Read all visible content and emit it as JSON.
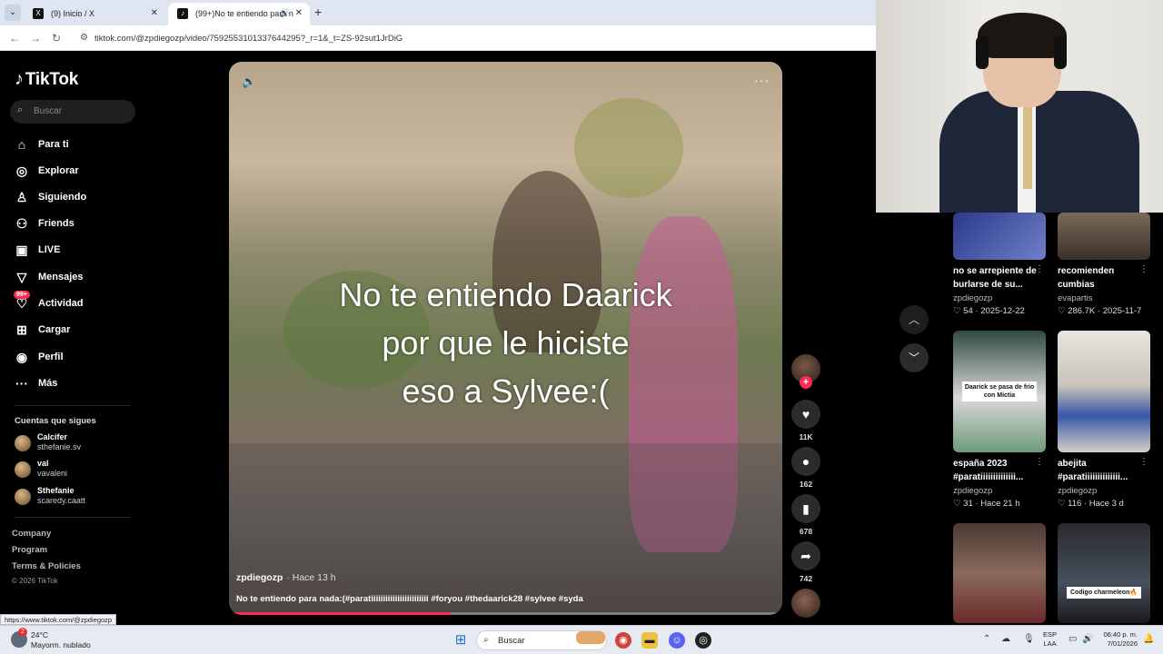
{
  "browser": {
    "tab1_title": "(9) Inicio / X",
    "tab2_title": "(99+)No te entiendo para n",
    "url": "tiktok.com/@zpdiegozp/video/7592553101337644295?_r=1&_t=ZS-92sut1JrDiG",
    "status_link": "https://www.tiktok.com/@zpdiegozp"
  },
  "sidebar": {
    "logo": "TikTok",
    "search_placeholder": "Buscar",
    "nav": [
      {
        "label": "Para ti",
        "icon": "home-icon"
      },
      {
        "label": "Explorar",
        "icon": "compass-icon"
      },
      {
        "label": "Siguiendo",
        "icon": "following-icon"
      },
      {
        "label": "Friends",
        "icon": "friends-icon"
      },
      {
        "label": "LIVE",
        "icon": "live-icon"
      },
      {
        "label": "Mensajes",
        "icon": "messages-icon"
      },
      {
        "label": "Actividad",
        "icon": "activity-icon",
        "badge": "99+"
      },
      {
        "label": "Cargar",
        "icon": "upload-icon"
      },
      {
        "label": "Perfil",
        "icon": "profile-icon"
      },
      {
        "label": "Más",
        "icon": "more-icon"
      }
    ],
    "following_title": "Cuentas que sigues",
    "following": [
      {
        "name": "Calcifer",
        "handle": "sthefanie.sv"
      },
      {
        "name": "val",
        "handle": "vavaleni"
      },
      {
        "name": "Sthefanie",
        "handle": "scaredy.caatt"
      }
    ],
    "footer_links": [
      "Company",
      "Program",
      "Terms & Policies"
    ],
    "copyright": "© 2026 TikTok"
  },
  "video": {
    "caption_lines": [
      "No te entiendo Daarick",
      "por que le hiciste",
      "eso a Sylvee:("
    ],
    "author": "zpdiegozp",
    "time": "· Hace 13 h",
    "description": "No te entiendo para nada:(#paratiiiiiiiiiiiiiiiiiiiiiiii #foryou #thedaarick28 #sylvee #syda",
    "progress": 0.4,
    "likes": "11K",
    "comments": "162",
    "saves": "678",
    "shares": "742"
  },
  "related": [
    {
      "title": "no se arrepiente de burlarse de su...",
      "author": "zpdiegozp",
      "likes": "54",
      "date": "2025-12-22",
      "thumb_text": ""
    },
    {
      "title": "recomienden cumbias",
      "author": "evapartis",
      "likes": "286.7K",
      "date": "2025-11-7",
      "thumb_text": ""
    },
    {
      "title": "españa 2023 #paratiiiiiiiiiiiiii...",
      "author": "zpdiegozp",
      "likes": "31",
      "date": "Hace 21 h",
      "thumb_text": "Daarick se pasa de frío con Mictia"
    },
    {
      "title": "abejita #paratiiiiiiiiiiiiii...",
      "author": "zpdiegozp",
      "likes": "116",
      "date": "Hace 3 d",
      "thumb_text": ""
    },
    {
      "title": "",
      "author": "",
      "likes": "",
      "date": "",
      "thumb_text": ""
    },
    {
      "title": "",
      "author": "",
      "likes": "",
      "date": "",
      "thumb_text": "Codigo charmeleon🔥"
    }
  ],
  "taskbar": {
    "temp": "24°C",
    "weather": "Mayorm. nublado",
    "weather_badge": "2",
    "search": "Buscar",
    "lang1": "ESP",
    "lang2": "LAA",
    "time": "06:40 p. m.",
    "date": "7/01/2026"
  },
  "colors": {
    "accent": "#fe2c55",
    "background": "#000000"
  }
}
